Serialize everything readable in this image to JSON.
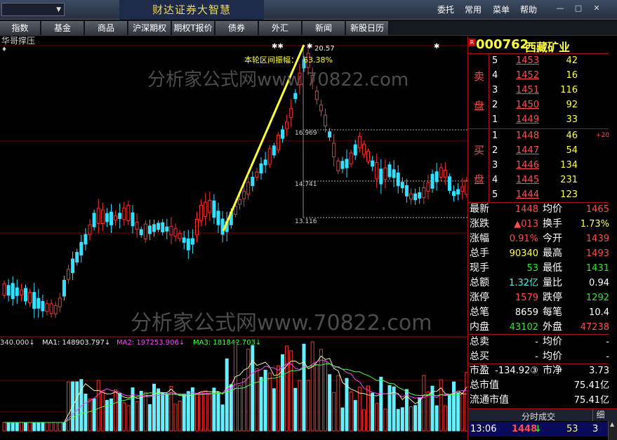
{
  "app": {
    "title": "财达证券大智慧",
    "menu": [
      "委托",
      "常用",
      "菜单",
      "帮助"
    ]
  },
  "tabs": [
    "指数",
    "基金",
    "商品",
    "沪深期权",
    "期权T报价",
    "债券",
    "外汇",
    "新闻",
    "新股日历"
  ],
  "chart": {
    "indicator_name": "华哥撑压",
    "range_label": "本轮区间振幅：",
    "range_value": "63.38%",
    "peak_label": "20.57",
    "levels": [
      "16.969",
      "14.741",
      "13.116"
    ],
    "volume_legend": {
      "vol": "340.000↓",
      "ma1": "MA1: 148903.797↓",
      "ma2": "MA2: 197253.906↓",
      "ma3": "MA3: 181842.703↓"
    },
    "watermark": "分析家公式网www.70822.com"
  },
  "stock": {
    "badge": "R",
    "code": "000762",
    "name": "西藏矿业"
  },
  "order_book": {
    "sell_label": [
      "卖",
      "盘"
    ],
    "buy_label": [
      "买",
      "盘"
    ],
    "sell": [
      {
        "level": "5",
        "price": "1453",
        "vol": "42"
      },
      {
        "level": "4",
        "price": "1452",
        "vol": "16"
      },
      {
        "level": "3",
        "price": "1451",
        "vol": "116"
      },
      {
        "level": "2",
        "price": "1450",
        "vol": "92"
      },
      {
        "level": "1",
        "price": "1449",
        "vol": "33"
      }
    ],
    "buy": [
      {
        "level": "1",
        "price": "1448",
        "vol": "46",
        "delta": "+20"
      },
      {
        "level": "2",
        "price": "1447",
        "vol": "54"
      },
      {
        "level": "3",
        "price": "1446",
        "vol": "134"
      },
      {
        "level": "4",
        "price": "1445",
        "vol": "231"
      },
      {
        "level": "5",
        "price": "1444",
        "vol": "123"
      }
    ]
  },
  "stats": [
    {
      "l1": "最新",
      "v1": "1448",
      "c1": "red",
      "l2": "均价",
      "v2": "1465",
      "c2": "red"
    },
    {
      "l1": "涨跌",
      "v1": "▲013",
      "c1": "red",
      "l2": "换手",
      "v2": "1.73%",
      "c2": "yel"
    },
    {
      "l1": "涨幅",
      "v1": "0.91%",
      "c1": "red",
      "l2": "今开",
      "v2": "1439",
      "c2": "red"
    },
    {
      "l1": "总手",
      "v1": "90340",
      "c1": "yel",
      "l2": "最高",
      "v2": "1493",
      "c2": "red"
    },
    {
      "l1": "现手",
      "v1": "53",
      "c1": "green",
      "l2": "最低",
      "v2": "1431",
      "c2": "green"
    },
    {
      "l1": "总额",
      "v1": "1.32亿",
      "c1": "cyan",
      "l2": "量比",
      "v2": "0.94",
      "c2": "wht"
    },
    {
      "l1": "涨停",
      "v1": "1579",
      "c1": "red",
      "l2": "跌停",
      "v2": "1292",
      "c2": "green"
    },
    {
      "l1": "总笔",
      "v1": "8659",
      "c1": "wht",
      "l2": "每笔",
      "v2": "10.4",
      "c2": "wht"
    },
    {
      "l1": "内盘",
      "v1": "43102",
      "c1": "green",
      "l2": "外盘",
      "v2": "47238",
      "c2": "red"
    }
  ],
  "stats2": [
    {
      "l1": "总卖",
      "v1": "-",
      "l2": "均价",
      "v2": "-"
    },
    {
      "l1": "总买",
      "v1": "-",
      "l2": "均价",
      "v2": "-"
    }
  ],
  "stats3": [
    {
      "l1": "市盈",
      "v1": "-134.92③",
      "l2": "市净",
      "v2": "3.73"
    },
    {
      "l1": "总市值",
      "v1": "",
      "l2": "",
      "v2": "75.41亿"
    },
    {
      "l1": "流通市值",
      "v1": "",
      "l2": "",
      "v2": "75.41亿"
    }
  ],
  "ticks_header": {
    "label": "分时成交",
    "button": "细"
  },
  "tick": {
    "time": "13:06",
    "price": "1448",
    "arrow": "↓",
    "vol": "53",
    "n": "3"
  }
}
